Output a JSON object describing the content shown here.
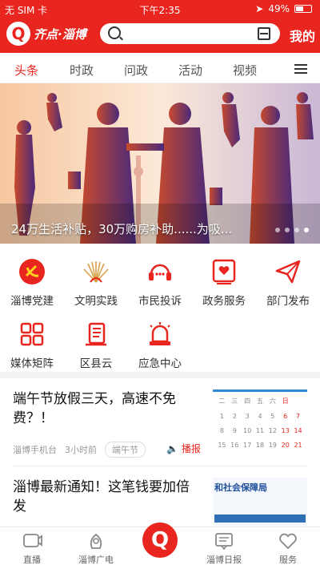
{
  "status": {
    "carrier": "无 SIM 卡",
    "time": "下午2:35",
    "battery": "49%",
    "battery_level": 0.49
  },
  "header": {
    "logo_text": "齐点·淄博",
    "mine_label": "我的"
  },
  "tabs": [
    {
      "label": "头条",
      "active": true
    },
    {
      "label": "时政",
      "active": false
    },
    {
      "label": "问政",
      "active": false
    },
    {
      "label": "活动",
      "active": false
    },
    {
      "label": "视频",
      "active": false
    }
  ],
  "banner": {
    "caption": "24万生活补贴，30万购房补助......为吸..."
  },
  "services": [
    {
      "label": "淄博党建",
      "icon": "party-emblem-icon"
    },
    {
      "label": "文明实践",
      "icon": "sunburst-icon"
    },
    {
      "label": "市民投诉",
      "icon": "headset-icon"
    },
    {
      "label": "政务服务",
      "icon": "heart-doc-icon"
    },
    {
      "label": "部门发布",
      "icon": "paper-plane-icon"
    },
    {
      "label": "媒体矩阵",
      "icon": "matrix-icon"
    },
    {
      "label": "区县云",
      "icon": "book-icon"
    },
    {
      "label": "应急中心",
      "icon": "alarm-light-icon"
    }
  ],
  "news": [
    {
      "title": "端午节放假三天，高速不免费？！",
      "source": "淄博手机台",
      "time": "3小时前",
      "tag": "端午节",
      "play": "播报"
    },
    {
      "title": "淄博最新通知！这笔钱要加倍发",
      "thumb_text": "和社会保障局"
    }
  ],
  "calendar": [
    "二",
    "三",
    "四",
    "五",
    "六",
    "日",
    "",
    "1",
    "2",
    "3",
    "4",
    "5",
    "6",
    "7",
    "8",
    "9",
    "10",
    "11",
    "12",
    "13",
    "14",
    "15",
    "16",
    "17",
    "18",
    "19",
    "20",
    "21"
  ],
  "bottom_nav": [
    {
      "label": "直播"
    },
    {
      "label": "淄博广电"
    },
    {
      "label": ""
    },
    {
      "label": "淄博日报"
    },
    {
      "label": "服务"
    }
  ],
  "colors": {
    "brand": "#e8251f"
  }
}
